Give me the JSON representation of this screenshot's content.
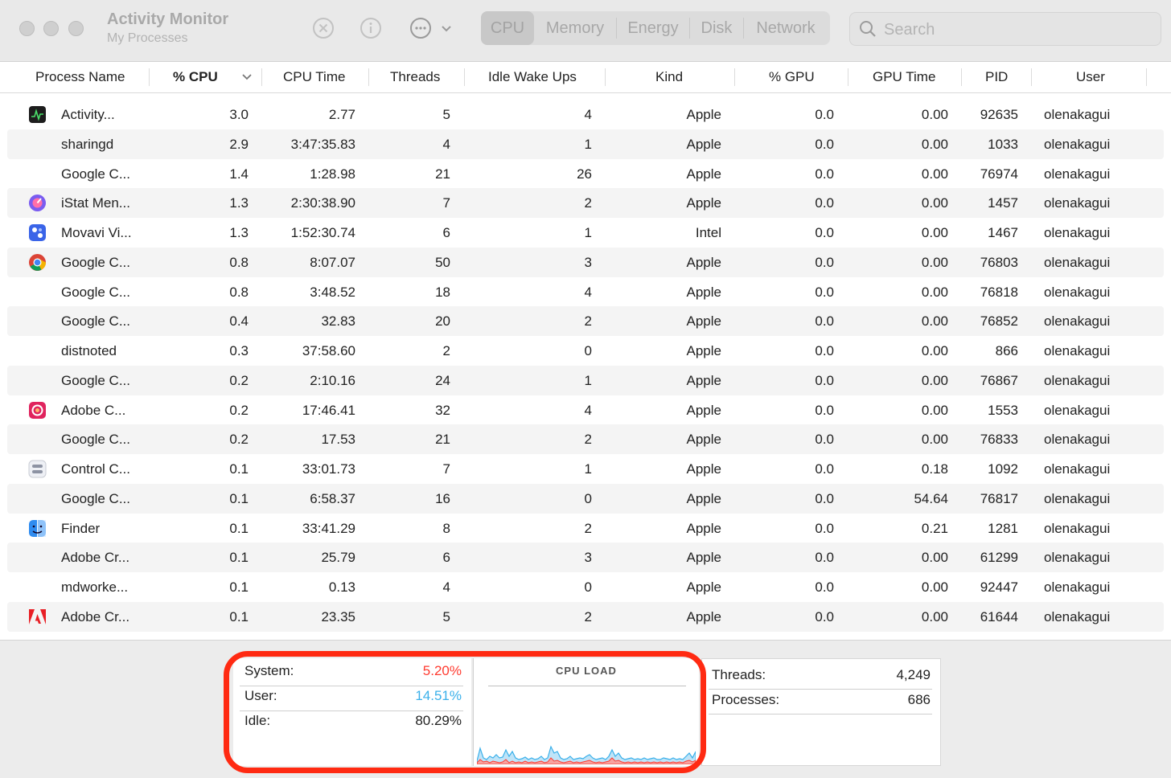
{
  "app": {
    "title": "Activity Monitor",
    "subtitle": "My Processes"
  },
  "toolbar": {
    "stop_icon": "stop-process-icon",
    "info_icon": "info-icon",
    "more_icon": "ellipsis-icon",
    "tabs": [
      {
        "label": "CPU",
        "active": true
      },
      {
        "label": "Memory",
        "active": false
      },
      {
        "label": "Energy",
        "active": false
      },
      {
        "label": "Disk",
        "active": false
      },
      {
        "label": "Network",
        "active": false
      }
    ]
  },
  "search": {
    "placeholder": "Search",
    "value": ""
  },
  "columns": [
    "Process Name",
    "% CPU",
    "CPU Time",
    "Threads",
    "Idle Wake Ups",
    "Kind",
    "% GPU",
    "GPU Time",
    "PID",
    "User"
  ],
  "sort": {
    "column": "% CPU",
    "direction": "descending"
  },
  "rows": [
    {
      "icon": "activity-monitor-icon",
      "name": "Activity...",
      "cpu": "3.0",
      "cpu_time": "2.77",
      "threads": "5",
      "idle": "4",
      "kind": "Apple",
      "gpu": "0.0",
      "gpu_time": "0.00",
      "pid": "92635",
      "user": "olenakagui"
    },
    {
      "icon": "",
      "name": "sharingd",
      "cpu": "2.9",
      "cpu_time": "3:47:35.83",
      "threads": "4",
      "idle": "1",
      "kind": "Apple",
      "gpu": "0.0",
      "gpu_time": "0.00",
      "pid": "1033",
      "user": "olenakagui"
    },
    {
      "icon": "",
      "name": "Google C...",
      "cpu": "1.4",
      "cpu_time": "1:28.98",
      "threads": "21",
      "idle": "26",
      "kind": "Apple",
      "gpu": "0.0",
      "gpu_time": "0.00",
      "pid": "76974",
      "user": "olenakagui"
    },
    {
      "icon": "istat-menus-icon",
      "name": "iStat Men...",
      "cpu": "1.3",
      "cpu_time": "2:30:38.90",
      "threads": "7",
      "idle": "2",
      "kind": "Apple",
      "gpu": "0.0",
      "gpu_time": "0.00",
      "pid": "1457",
      "user": "olenakagui"
    },
    {
      "icon": "movavi-icon",
      "name": "Movavi Vi...",
      "cpu": "1.3",
      "cpu_time": "1:52:30.74",
      "threads": "6",
      "idle": "1",
      "kind": "Intel",
      "gpu": "0.0",
      "gpu_time": "0.00",
      "pid": "1467",
      "user": "olenakagui"
    },
    {
      "icon": "chrome-icon",
      "name": "Google C...",
      "cpu": "0.8",
      "cpu_time": "8:07.07",
      "threads": "50",
      "idle": "3",
      "kind": "Apple",
      "gpu": "0.0",
      "gpu_time": "0.00",
      "pid": "76803",
      "user": "olenakagui"
    },
    {
      "icon": "",
      "name": "Google C...",
      "cpu": "0.8",
      "cpu_time": "3:48.52",
      "threads": "18",
      "idle": "4",
      "kind": "Apple",
      "gpu": "0.0",
      "gpu_time": "0.00",
      "pid": "76818",
      "user": "olenakagui"
    },
    {
      "icon": "",
      "name": "Google C...",
      "cpu": "0.4",
      "cpu_time": "32.83",
      "threads": "20",
      "idle": "2",
      "kind": "Apple",
      "gpu": "0.0",
      "gpu_time": "0.00",
      "pid": "76852",
      "user": "olenakagui"
    },
    {
      "icon": "",
      "name": "distnoted",
      "cpu": "0.3",
      "cpu_time": "37:58.60",
      "threads": "2",
      "idle": "0",
      "kind": "Apple",
      "gpu": "0.0",
      "gpu_time": "0.00",
      "pid": "866",
      "user": "olenakagui"
    },
    {
      "icon": "",
      "name": "Google C...",
      "cpu": "0.2",
      "cpu_time": "2:10.16",
      "threads": "24",
      "idle": "1",
      "kind": "Apple",
      "gpu": "0.0",
      "gpu_time": "0.00",
      "pid": "76867",
      "user": "olenakagui"
    },
    {
      "icon": "adobe-cc-icon",
      "name": "Adobe C...",
      "cpu": "0.2",
      "cpu_time": "17:46.41",
      "threads": "32",
      "idle": "4",
      "kind": "Apple",
      "gpu": "0.0",
      "gpu_time": "0.00",
      "pid": "1553",
      "user": "olenakagui"
    },
    {
      "icon": "",
      "name": "Google C...",
      "cpu": "0.2",
      "cpu_time": "17.53",
      "threads": "21",
      "idle": "2",
      "kind": "Apple",
      "gpu": "0.0",
      "gpu_time": "0.00",
      "pid": "76833",
      "user": "olenakagui"
    },
    {
      "icon": "control-center-icon",
      "name": "Control C...",
      "cpu": "0.1",
      "cpu_time": "33:01.73",
      "threads": "7",
      "idle": "1",
      "kind": "Apple",
      "gpu": "0.0",
      "gpu_time": "0.18",
      "pid": "1092",
      "user": "olenakagui"
    },
    {
      "icon": "",
      "name": "Google C...",
      "cpu": "0.1",
      "cpu_time": "6:58.37",
      "threads": "16",
      "idle": "0",
      "kind": "Apple",
      "gpu": "0.0",
      "gpu_time": "54.64",
      "pid": "76817",
      "user": "olenakagui"
    },
    {
      "icon": "finder-icon",
      "name": "Finder",
      "cpu": "0.1",
      "cpu_time": "33:41.29",
      "threads": "8",
      "idle": "2",
      "kind": "Apple",
      "gpu": "0.0",
      "gpu_time": "0.21",
      "pid": "1281",
      "user": "olenakagui"
    },
    {
      "icon": "",
      "name": "Adobe Cr...",
      "cpu": "0.1",
      "cpu_time": "25.79",
      "threads": "6",
      "idle": "3",
      "kind": "Apple",
      "gpu": "0.0",
      "gpu_time": "0.00",
      "pid": "61299",
      "user": "olenakagui"
    },
    {
      "icon": "",
      "name": "mdworke...",
      "cpu": "0.1",
      "cpu_time": "0.13",
      "threads": "4",
      "idle": "0",
      "kind": "Apple",
      "gpu": "0.0",
      "gpu_time": "0.00",
      "pid": "92447",
      "user": "olenakagui"
    },
    {
      "icon": "adobe-icon",
      "name": "Adobe Cr...",
      "cpu": "0.1",
      "cpu_time": "23.35",
      "threads": "5",
      "idle": "2",
      "kind": "Apple",
      "gpu": "0.0",
      "gpu_time": "0.00",
      "pid": "61644",
      "user": "olenakagui"
    }
  ],
  "summary": {
    "system_label": "System:",
    "system_value": "5.20%",
    "user_label": "User:",
    "user_value": "14.51%",
    "idle_label": "Idle:",
    "idle_value": "80.29%",
    "graph_title": "CPU LOAD",
    "threads_label": "Threads:",
    "threads_value": "4,249",
    "processes_label": "Processes:",
    "processes_value": "686"
  },
  "colors": {
    "system": "#ff3b30",
    "user": "#3ab0ea",
    "highlight": "#ff2a12"
  }
}
